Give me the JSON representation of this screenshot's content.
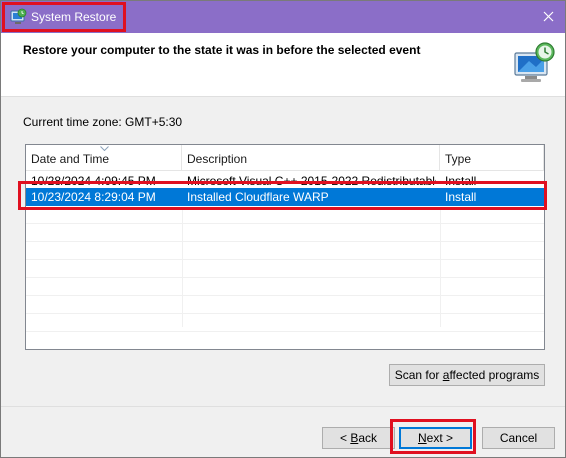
{
  "window": {
    "title": "System Restore",
    "close_glyph": "✕"
  },
  "header": {
    "heading": "Restore your computer to the state it was in before the selected event"
  },
  "timezone_text": "Current time zone: GMT+5:30",
  "list": {
    "columns": [
      "Date and Time",
      "Description",
      "Type"
    ],
    "rows": [
      {
        "date": "10/28/2024 4:09:45 PM",
        "description": "Microsoft Visual C++ 2015-2022 Redistributable ...",
        "type": "Install"
      },
      {
        "date": "10/23/2024 8:29:04 PM",
        "description": "Installed Cloudflare WARP",
        "type": "Install",
        "selected": true
      }
    ]
  },
  "buttons": {
    "scan_pre": "Scan for ",
    "scan_u": "a",
    "scan_post": "ffected programs",
    "back_pre": "< ",
    "back_u": "B",
    "back_post": "ack",
    "next_u": "N",
    "next_post": "ext >",
    "cancel": "Cancel"
  },
  "colors": {
    "titlebar": "#8b6ec8",
    "selection": "#0078d7",
    "highlight_box": "#e01020"
  }
}
